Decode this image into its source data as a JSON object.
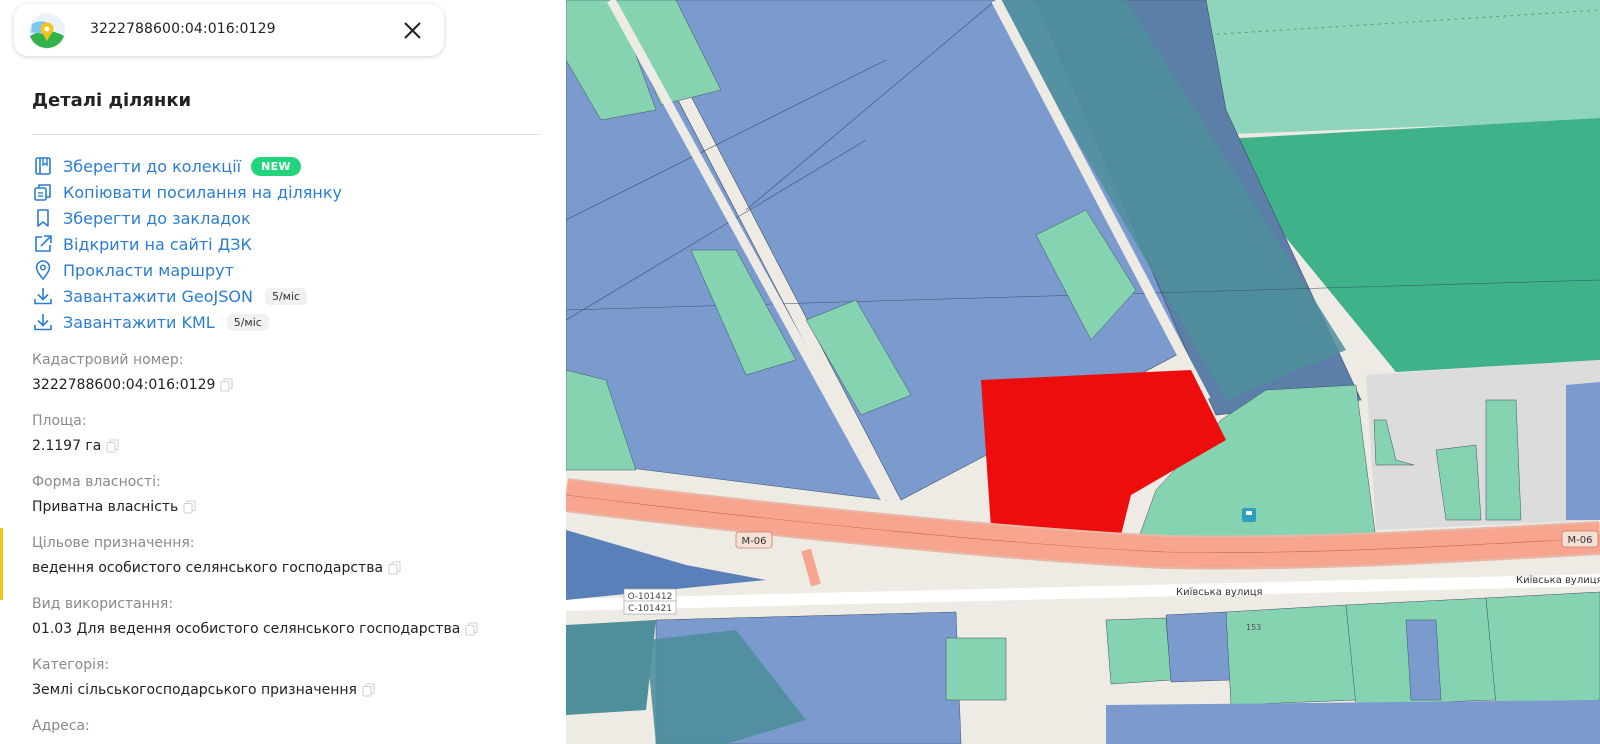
{
  "search": {
    "query": "3222788600:04:016:0129"
  },
  "panel": {
    "title": "Деталі ділянки"
  },
  "actions": [
    {
      "icon": "book-icon",
      "label": "Зберегти до колекції",
      "badge": "NEW"
    },
    {
      "icon": "copy-link-icon",
      "label": "Копіювати посилання на ділянку"
    },
    {
      "icon": "bookmark-icon",
      "label": "Зберегти до закладок"
    },
    {
      "icon": "external-link-icon",
      "label": "Відкрити на сайті ДЗК"
    },
    {
      "icon": "location-pin-icon",
      "label": "Прокласти маршрут"
    },
    {
      "icon": "download-icon",
      "label": "Завантажити GeoJSON",
      "limit": "5/міс"
    },
    {
      "icon": "download-icon",
      "label": "Завантажити KML",
      "limit": "5/міс"
    }
  ],
  "fields": [
    {
      "label": "Кадастровий номер:",
      "value": "3222788600:04:016:0129"
    },
    {
      "label": "Площа:",
      "value": "2.1197 га"
    },
    {
      "label": "Форма власності:",
      "value": "Приватна власність"
    },
    {
      "label": "Цільове призначення:",
      "value": "ведення особистого селянського господарства"
    },
    {
      "label": "Вид використання:",
      "value": "01.03 Для ведення особистого селянського господарства"
    },
    {
      "label": "Категорія:",
      "value": "Землі сільськогосподарського призначення"
    },
    {
      "label": "Адреса:",
      "value": ""
    }
  ],
  "map": {
    "road_shield_1": "М-06",
    "road_shield_2": "М-06",
    "street_1": "Київська вулиця",
    "street_2": "Київська вулиця",
    "road_code_1": "О-101412",
    "road_code_2": "С-101421",
    "house_number": "153",
    "colors": {
      "selected_parcel": "#ee0d0d",
      "parcel_blue": "#7b9bcf",
      "parcel_green": "#86d3b2",
      "parcel_teal": "#4e8f9b",
      "forest": "#3fb28a",
      "road": "#f7a58e",
      "background": "#eeeae4"
    }
  }
}
